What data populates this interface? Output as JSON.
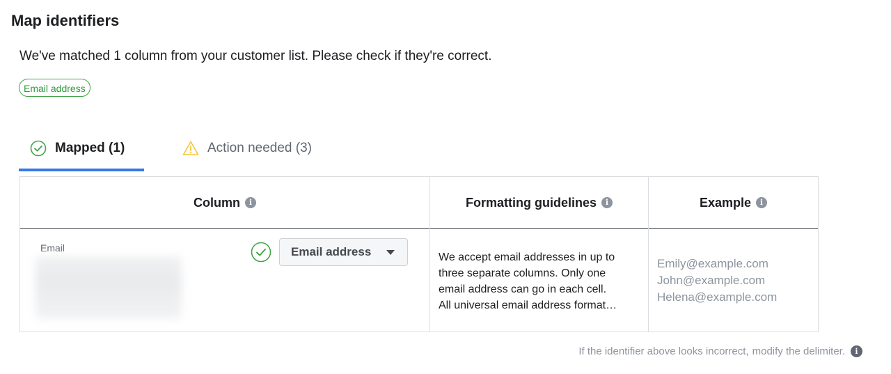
{
  "page": {
    "title": "Map identifiers",
    "subtitle": "We've matched 1 column from your customer list. Please check if they're correct.",
    "matched_tag": "Email address"
  },
  "tabs": [
    {
      "label": "Mapped (1)",
      "icon": "check-circle-icon",
      "active": true
    },
    {
      "label": "Action needed (3)",
      "icon": "warning-icon",
      "active": false
    }
  ],
  "table": {
    "headers": {
      "column": "Column",
      "formatting": "Formatting guidelines",
      "example": "Example"
    },
    "row": {
      "column_name": "Email",
      "mapped_identifier": "Email address",
      "formatting_lines": [
        "We accept email addresses in up to",
        "three separate columns. Only one",
        "email address can go in each cell.",
        "All universal email address format…"
      ],
      "examples": [
        "Emily@example.com",
        "John@example.com",
        "Helena@example.com"
      ]
    }
  },
  "footer": {
    "text": "If the identifier above looks incorrect,",
    "link": "modify the delimiter."
  },
  "colors": {
    "accent": "#3578e5",
    "success": "#42a34a",
    "warning": "#f5c33b",
    "muted": "#8d949e"
  }
}
